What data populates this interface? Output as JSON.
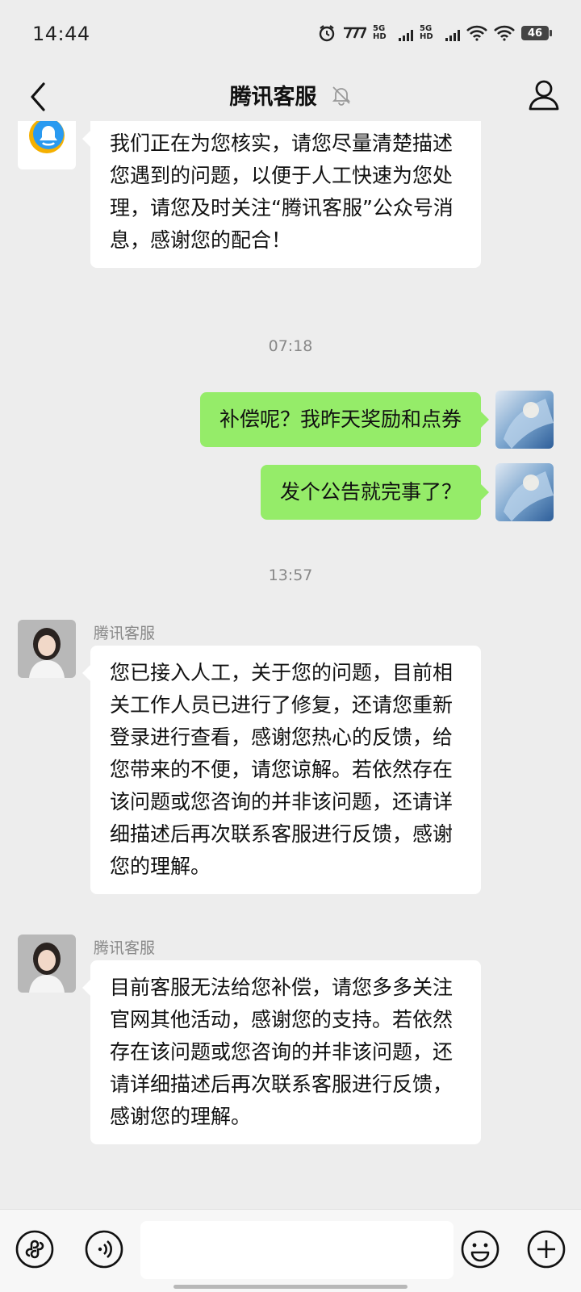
{
  "status_bar": {
    "time": "14:44",
    "net_left": "5G HD",
    "net_right": "5G HD",
    "battery": "46"
  },
  "header": {
    "title": "腾讯客服"
  },
  "chat": {
    "messages": [
      {
        "side": "in",
        "avatar": "tencent-logo",
        "text": "我们正在为您核实，请您尽量清楚描述您遇到的问题，以便于人工快速为您处理，请您及时关注“腾讯客服”公众号消息，感谢您的配合！"
      },
      {
        "type": "timestamp",
        "text": "07:18"
      },
      {
        "side": "out",
        "text": "补偿呢？我昨天奖励和点券"
      },
      {
        "side": "out",
        "text": "发个公告就完事了？"
      },
      {
        "type": "timestamp",
        "text": "13:57"
      },
      {
        "side": "in",
        "sender": "腾讯客服",
        "avatar": "agent-photo",
        "text": "您已接入人工，关于您的问题，目前相关工作人员已进行了修复，还请您重新登录进行查看，感谢您热心的反馈，给您带来的不便，请您谅解。若依然存在该问题或您咨询的并非该问题，还请详细描述后再次联系客服进行反馈，感谢您的理解。"
      },
      {
        "side": "in",
        "sender": "腾讯客服",
        "avatar": "agent-photo",
        "text": "目前客服无法给您补偿，请您多多关注官网其他活动，感谢您的支持。若依然存在该问题或您咨询的并非该问题，还请详细描述后再次联系客服进行反馈，感谢您的理解。"
      }
    ]
  },
  "input_bar": {
    "value": "",
    "icons": [
      "mini-program-icon",
      "voice-icon",
      "emoji-icon",
      "plus-icon"
    ]
  },
  "colors": {
    "background": "#ededed",
    "incoming_bubble": "#ffffff",
    "outgoing_bubble": "#95ec69",
    "timestamp": "#888888"
  }
}
